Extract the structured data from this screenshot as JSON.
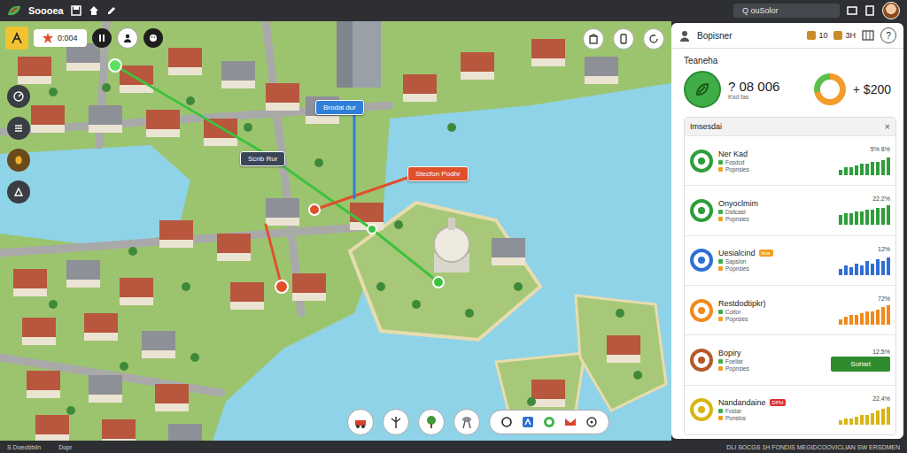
{
  "app": {
    "title": "Soooea"
  },
  "search": {
    "text": "Q ouSolor"
  },
  "map": {
    "counter": "0:004",
    "labels": [
      {
        "text": "Brodal dur",
        "color": "#2f7fd8"
      },
      {
        "text": "Scnb Rur",
        "color": "#3a4656"
      },
      {
        "text": "Stecfon Podhr",
        "color": "#e0502a"
      }
    ]
  },
  "panel": {
    "title": "Bopisner",
    "stats": [
      "10",
      "3H"
    ],
    "help": "?",
    "heading": "Teaneha",
    "summary": {
      "value": "? 08 006",
      "caption": "Ksd fas",
      "gain": "+ $200",
      "ring_level": 0.72
    }
  },
  "list": {
    "title": "Imsesdai",
    "close": "×",
    "rows": [
      {
        "name": "Ner Kad",
        "kind": "bars",
        "color": "#2e9e3a",
        "subs": [
          "Fosdcd",
          "Popnsies"
        ],
        "reading": "5% 8%",
        "values": [
          3,
          4,
          4,
          5,
          6,
          6,
          7,
          7,
          8,
          9
        ]
      },
      {
        "name": "Onyoclmim",
        "kind": "bars",
        "color": "#2e9e3a",
        "subs": [
          "Dslicast",
          "Popnsies"
        ],
        "reading": "22.2%",
        "values": [
          5,
          6,
          6,
          7,
          7,
          8,
          8,
          9,
          9,
          10
        ]
      },
      {
        "name": "Uesialcind",
        "badge": {
          "text": "bne",
          "color": "#f0a020"
        },
        "kind": "bars",
        "color": "#2f6fd6",
        "subs": [
          "Sapsion",
          "Popnsies"
        ],
        "reading": "12%",
        "values": [
          3,
          5,
          4,
          6,
          5,
          7,
          6,
          8,
          7,
          9
        ]
      },
      {
        "name": "Restdodtipkr)",
        "kind": "bars",
        "color": "#f08a1c",
        "subs": [
          "Coitor",
          "Poprsies"
        ],
        "reading": "72%",
        "values": [
          3,
          4,
          5,
          5,
          6,
          7,
          7,
          8,
          9,
          10
        ]
      },
      {
        "name": "Bopiry",
        "kind": "button",
        "color": "#b5582a",
        "subs": [
          "Foeliar",
          "Popnsies"
        ],
        "reading": "12.5%",
        "button": "Sohiet"
      },
      {
        "name": "Nandandaine",
        "badge": {
          "text": "DPH",
          "color": "#e03030"
        },
        "kind": "bars",
        "color": "#d8b414",
        "subs": [
          "Fosiar",
          "Ponslos"
        ],
        "reading": "22.4%",
        "values": [
          2,
          3,
          3,
          4,
          5,
          5,
          6,
          7,
          8,
          9
        ]
      }
    ]
  },
  "status_bar": {
    "left": [
      "S Doeobbiin",
      "Dopr"
    ],
    "right": "DLI SOCGS 1H FONDIS MEGIDCOOVICLIAN SW ERSDMEN"
  }
}
